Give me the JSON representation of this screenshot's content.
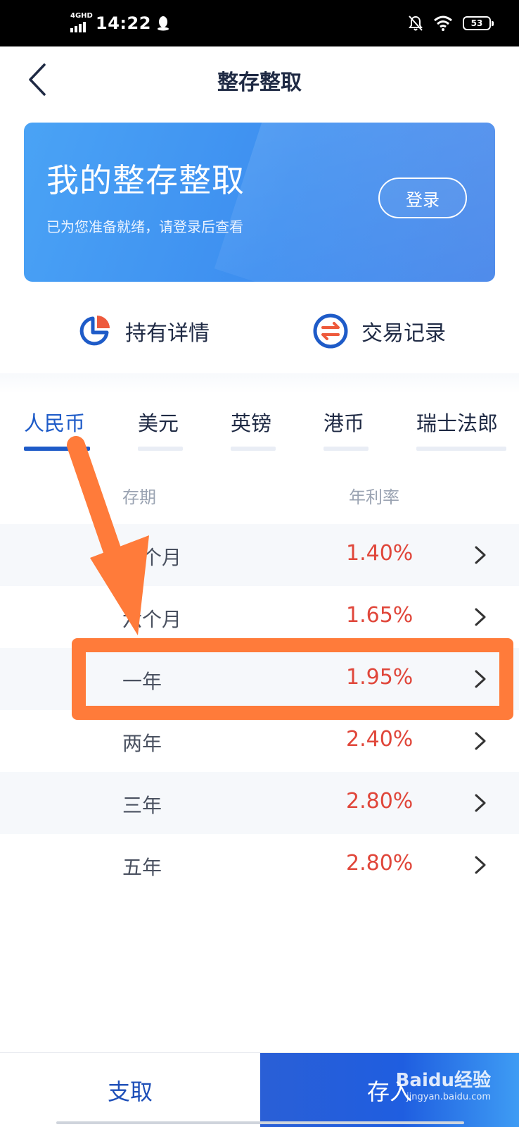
{
  "status_bar": {
    "network": "4GHD",
    "time": "14:22",
    "battery": "53"
  },
  "header": {
    "title": "整存整取"
  },
  "banner": {
    "title": "我的整存整取",
    "subtitle": "已为您准备就绪，请登录后查看",
    "login_label": "登录"
  },
  "quick_links": [
    {
      "label": "持有详情",
      "icon": "pie-chart-icon"
    },
    {
      "label": "交易记录",
      "icon": "exchange-icon"
    }
  ],
  "tabs": [
    {
      "label": "人民币",
      "active": true
    },
    {
      "label": "美元",
      "active": false
    },
    {
      "label": "英镑",
      "active": false
    },
    {
      "label": "港币",
      "active": false
    },
    {
      "label": "瑞士法郎",
      "active": false
    }
  ],
  "table": {
    "headers": {
      "term": "存期",
      "rate": "年利率"
    },
    "rows": [
      {
        "term": "三个月",
        "rate": "1.40%"
      },
      {
        "term": "六个月",
        "rate": "1.65%"
      },
      {
        "term": "一年",
        "rate": "1.95%"
      },
      {
        "term": "两年",
        "rate": "2.40%"
      },
      {
        "term": "三年",
        "rate": "2.80%"
      },
      {
        "term": "五年",
        "rate": "2.80%"
      }
    ]
  },
  "bottom_bar": {
    "withdraw_label": "支取",
    "deposit_label": "存入",
    "watermark_main": "Baidu经验",
    "watermark_sub": "jingyan.baidu.com"
  },
  "colors": {
    "accent": "#1e5bc8",
    "rate": "#e0463a",
    "annotation": "#ff7b3a"
  }
}
